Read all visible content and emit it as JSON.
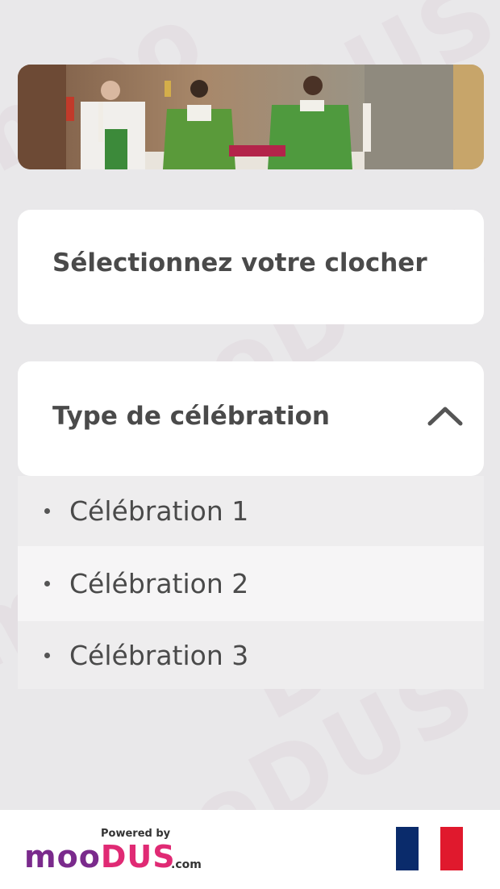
{
  "clocher": {
    "title": "Sélectionnez votre clocher"
  },
  "celebration": {
    "title": "Type de célébration",
    "options": [
      "Célébration 1",
      "Célébration 2",
      "Célébration 3"
    ]
  },
  "footer": {
    "powered_by": "Powered by",
    "brand_left": "moo",
    "brand_mid": "DUS",
    "brand_suffix": ".com"
  },
  "colors": {
    "brand_purple": "#7a2a8c",
    "brand_pink": "#e02a74",
    "flag_blue": "#0a2b6b",
    "flag_white": "#ffffff",
    "flag_red": "#e0192d"
  }
}
